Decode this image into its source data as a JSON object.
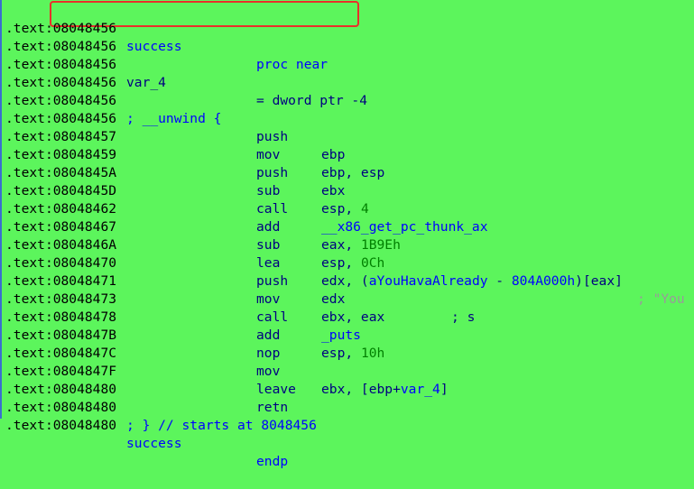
{
  "segment": ".text",
  "lines": [
    {
      "addr": "08048456",
      "name": "success",
      "mnemonic": "proc near",
      "operand": ""
    },
    {
      "addr": "08048456",
      "name": "",
      "mnemonic": "",
      "operand": ""
    },
    {
      "addr": "08048456",
      "name": "var_4",
      "mnemonic": "= dword ptr -4",
      "operand": ""
    },
    {
      "addr": "08048456",
      "name": "",
      "mnemonic": "",
      "operand": ""
    },
    {
      "addr": "08048456",
      "name": "; __unwind {",
      "mnemonic": "",
      "operand": ""
    },
    {
      "addr": "08048456",
      "name": "",
      "mnemonic": "push",
      "operand": "ebp"
    },
    {
      "addr": "08048457",
      "name": "",
      "mnemonic": "mov",
      "operand": "ebp, esp"
    },
    {
      "addr": "08048459",
      "name": "",
      "mnemonic": "push",
      "operand": "ebx"
    },
    {
      "addr": "0804845A",
      "name": "",
      "mnemonic": "sub",
      "operand": "esp, 4"
    },
    {
      "addr": "0804845D",
      "name": "",
      "mnemonic": "call",
      "operand": "__x86_get_pc_thunk_ax"
    },
    {
      "addr": "08048462",
      "name": "",
      "mnemonic": "add",
      "operand": "eax, 1B9Eh"
    },
    {
      "addr": "08048467",
      "name": "",
      "mnemonic": "sub",
      "operand": "esp, 0Ch"
    },
    {
      "addr": "0804846A",
      "name": "",
      "mnemonic": "lea",
      "operand": "edx, (aYouHavaAlready - 804A000h)[eax]",
      "comment": "; \"You"
    },
    {
      "addr": "08048470",
      "name": "",
      "mnemonic": "push",
      "operand": "edx",
      "comment": "; s"
    },
    {
      "addr": "08048471",
      "name": "",
      "mnemonic": "mov",
      "operand": "ebx, eax"
    },
    {
      "addr": "08048473",
      "name": "",
      "mnemonic": "call",
      "operand": "_puts"
    },
    {
      "addr": "08048478",
      "name": "",
      "mnemonic": "add",
      "operand": "esp, 10h"
    },
    {
      "addr": "0804847B",
      "name": "",
      "mnemonic": "nop",
      "operand": ""
    },
    {
      "addr": "0804847C",
      "name": "",
      "mnemonic": "mov",
      "operand": "ebx, [ebp+var_4]"
    },
    {
      "addr": "0804847F",
      "name": "",
      "mnemonic": "leave",
      "operand": ""
    },
    {
      "addr": "08048480",
      "name": "",
      "mnemonic": "retn",
      "operand": ""
    },
    {
      "addr": "08048480",
      "name": "; } // starts at 8048456",
      "mnemonic": "",
      "operand": ""
    },
    {
      "addr": "08048480",
      "name": "success",
      "mnemonic": "endp",
      "operand": ""
    }
  ],
  "colors": {
    "background": "#5cf55c",
    "highlight_box": "#e8302a"
  }
}
